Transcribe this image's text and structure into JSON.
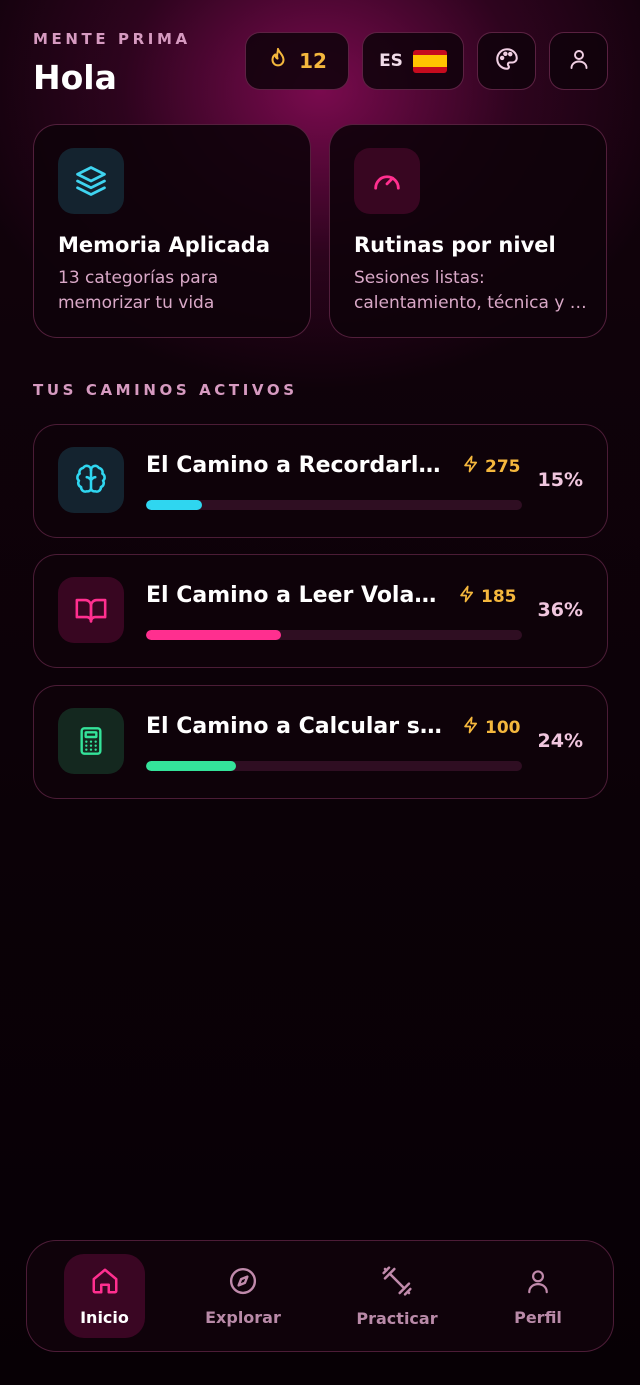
{
  "app": {
    "brand": "MENTE PRIMA",
    "greeting": "Hola"
  },
  "header": {
    "streak": {
      "icon": "flame-icon",
      "value": "12"
    },
    "language": {
      "code": "ES",
      "flag_icon": "spain-flag-icon"
    },
    "theme_icon": "palette-icon",
    "profile_icon": "user-icon"
  },
  "features": [
    {
      "icon": "layers-icon",
      "accent": "#3fd4f0",
      "title": "Memoria Aplicada",
      "description_line1": "13 categorías para",
      "description_line2": "memorizar tu vida"
    },
    {
      "icon": "gauge-icon",
      "accent": "#ff2f8f",
      "title": "Rutinas por nivel",
      "description_line1": "Sesiones listas:",
      "description_line2": "calentamiento, técnica y retos"
    }
  ],
  "paths_section": {
    "label": "TUS CAMINOS ACTIVOS",
    "paths": [
      {
        "icon": "brain-icon",
        "title": "El Camino a Recordarlo Todo",
        "xp": "275",
        "percent": "15%",
        "progress": 0.15,
        "color": "#2fd6f0",
        "icon_bg": "#14232f"
      },
      {
        "icon": "book-icon",
        "title": "El Camino a Leer Volando",
        "xp": "185",
        "percent": "36%",
        "progress": 0.36,
        "color": "#ff2f8f",
        "icon_bg": "#380621"
      },
      {
        "icon": "calculator-icon",
        "title": "El Camino a Calcular sin Calculadora",
        "xp": "100",
        "percent": "24%",
        "progress": 0.24,
        "color": "#34e39a",
        "icon_bg": "#14281f"
      }
    ]
  },
  "nav": {
    "items": [
      {
        "icon": "home-icon",
        "label": "Inicio",
        "active": true
      },
      {
        "icon": "compass-icon",
        "label": "Explorar",
        "active": false
      },
      {
        "icon": "dumbbell-icon",
        "label": "Practicar",
        "active": false
      },
      {
        "icon": "user-icon",
        "label": "Perfil",
        "active": false
      }
    ]
  },
  "colors": {
    "accent_pink": "#ff2f8f",
    "xp_gold": "#f4b73d",
    "muted_label": "#d69ac0"
  }
}
